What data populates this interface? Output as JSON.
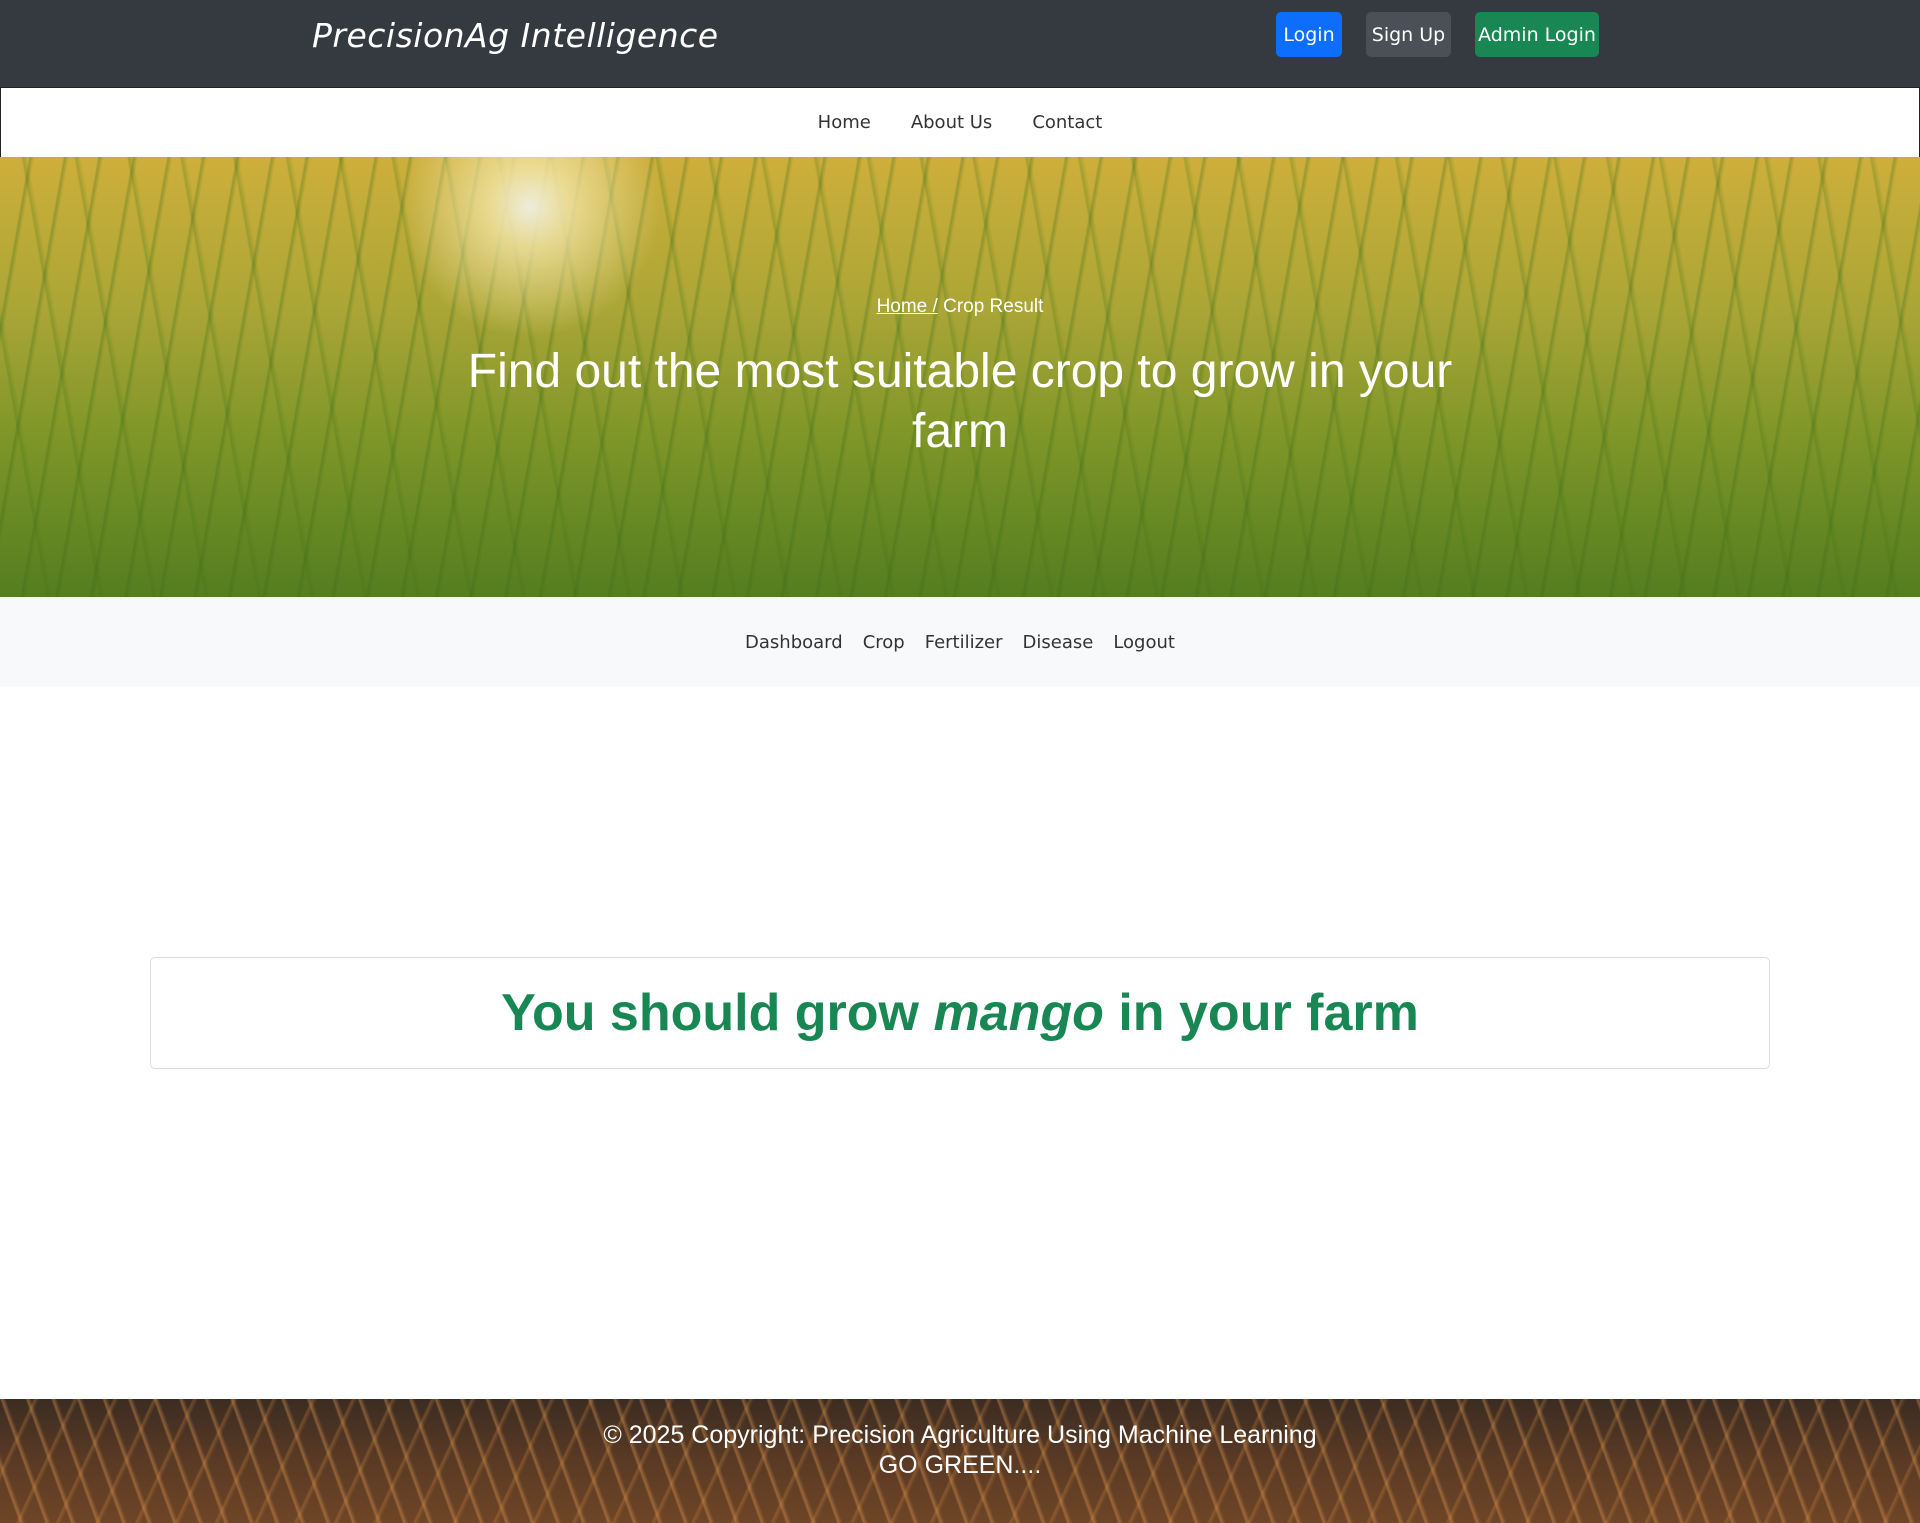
{
  "header": {
    "brand": "PrecisionAg Intelligence",
    "buttons": {
      "login": "Login",
      "signup": "Sign Up",
      "admin_login": "Admin Login"
    }
  },
  "nav": {
    "items": [
      "Home",
      "About Us",
      "Contact"
    ]
  },
  "hero": {
    "breadcrumb_home": "Home /",
    "breadcrumb_current": "Crop Result",
    "title": "Find out the most suitable crop to grow in your farm"
  },
  "dashboard_nav": {
    "items": [
      "Dashboard",
      "Crop",
      "Fertilizer",
      "Disease",
      "Logout"
    ]
  },
  "result": {
    "prefix": "You should grow ",
    "crop": "mango",
    "suffix": " in your farm"
  },
  "footer": {
    "copyright": "© 2025 Copyright: Precision Agriculture Using Machine Learning",
    "tagline": "GO GREEN...."
  },
  "colors": {
    "header_bg": "#343a40",
    "login_btn": "#0d6efd",
    "signup_btn": "#495057",
    "admin_btn": "#198754",
    "result_text": "#198754"
  }
}
